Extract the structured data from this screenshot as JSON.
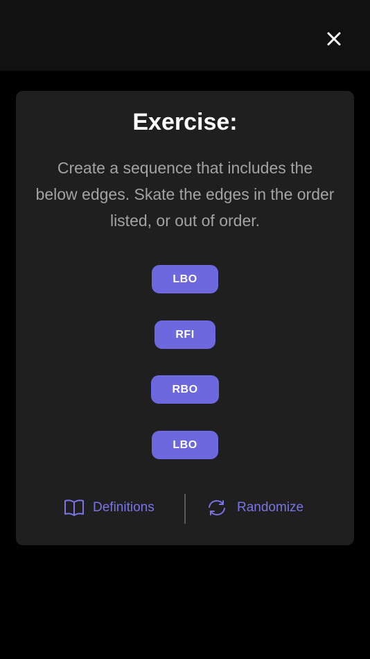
{
  "header": {
    "close_icon": "close-icon"
  },
  "card": {
    "title": "Exercise:",
    "description": "Create a sequence that includes the below edges. Skate the edges in the order listed, or out of order.",
    "edges": [
      "LBO",
      "RFI",
      "RBO",
      "LBO"
    ],
    "accent_color": "#6e68df"
  },
  "footer": {
    "definitions_label": "Definitions",
    "definitions_icon": "book-icon",
    "randomize_label": "Randomize",
    "randomize_icon": "refresh-icon"
  }
}
